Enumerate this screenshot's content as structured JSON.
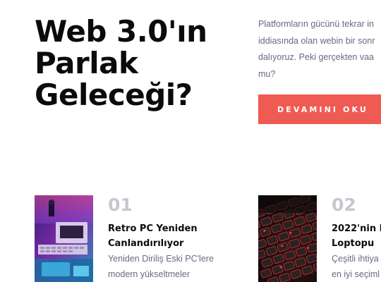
{
  "hero": {
    "title_lines": [
      "Web 3.0'ın",
      "Parlak",
      "Geleceği?"
    ],
    "description_lines": [
      "Platformların gücünü tekrar in",
      "iddiasında olan webin bir sonr",
      "dalıyoruz. Peki gerçekten vaa",
      "mu?"
    ],
    "cta_label": "DEVAMINI OKU"
  },
  "articles": [
    {
      "number": "01",
      "title_lines": [
        "Retro PC Yeniden",
        "Canlandırılıyor"
      ],
      "excerpt_lines": [
        "Yeniden Diriliş Eski PC'lere",
        "modern yükseltmeler"
      ],
      "thumbnail_icon": "retro-computer-photo"
    },
    {
      "number": "02",
      "title_lines": [
        "2022'nin E",
        "Loptopu"
      ],
      "excerpt_lines": [
        "Çeşitli ihtiya",
        "en iyi seçiml"
      ],
      "thumbnail_icon": "keyboard-red-backlight-photo"
    }
  ],
  "colors": {
    "accent": "#ef5b53",
    "heading": "#0b0b0b",
    "body_text": "#6b6783",
    "number_muted": "#c8c7cf"
  }
}
